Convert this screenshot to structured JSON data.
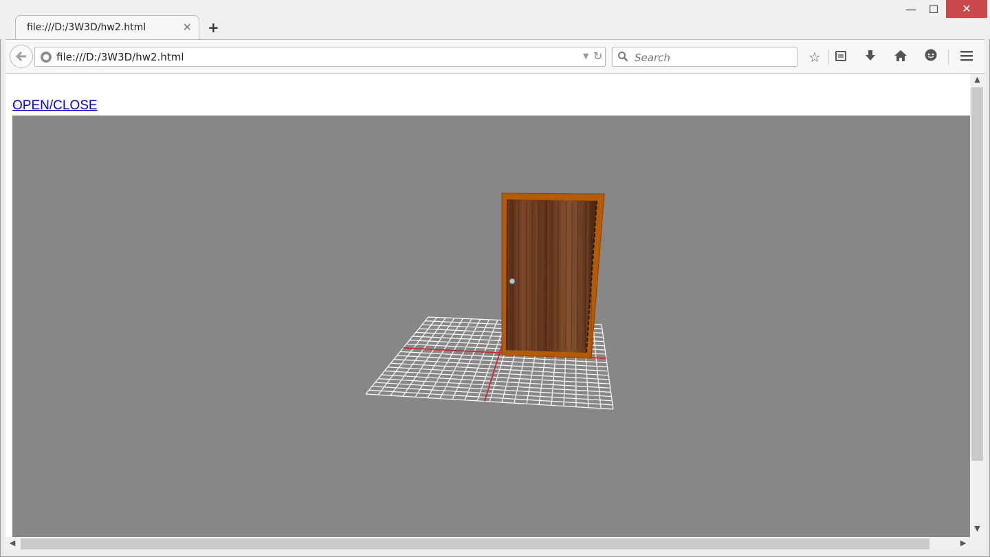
{
  "tab": {
    "title": "file:///D:/3W3D/hw2.html",
    "close_glyph": "✕"
  },
  "new_tab_glyph": "+",
  "window_controls": {
    "minimize": "—",
    "maximize": "☐",
    "close": "✕"
  },
  "navbar": {
    "url": "file:///D:/3W3D/hw2.html",
    "search_placeholder": "Search",
    "icons": [
      "back-arrow-icon",
      "globe-icon",
      "dropdown-icon",
      "reload-icon",
      "search-icon",
      "bookmark-star-icon",
      "reading-list-icon",
      "download-icon",
      "home-icon",
      "chat-icon",
      "menu-icon"
    ]
  },
  "page": {
    "link_label": "OPEN/CLOSE"
  },
  "scene": {
    "background": "#878787",
    "grid_color": "#ffffff",
    "axis_color": "#d11f1f",
    "door_frame_color": "#b55a05",
    "door_wood_color": "#6b3a1f"
  }
}
